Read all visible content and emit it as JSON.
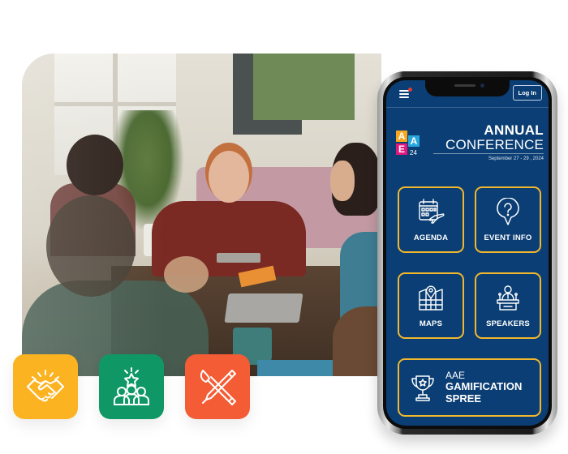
{
  "app": {
    "header": {
      "menu_icon": "hamburger-menu-icon",
      "notification_dot_color": "#e53935",
      "login_label": "Log In"
    },
    "brand": {
      "logo_letters": [
        "A",
        "A",
        "E"
      ],
      "logo_year": "24",
      "logo_colors": [
        "#f6a821",
        "#27a7de",
        "#e3177d"
      ],
      "title_line_1": "ANNUAL",
      "title_line_2": "CONFERENCE",
      "dates": "September 27 - 29 , 2024"
    },
    "nav_tiles": [
      {
        "label": "AGENDA",
        "icon": "calendar-plane-icon"
      },
      {
        "label": "EVENT INFO",
        "icon": "question-pin-icon"
      },
      {
        "label": "MAPS",
        "icon": "map-pin-icon"
      },
      {
        "label": "SPEAKERS",
        "icon": "speaker-podium-icon"
      }
    ],
    "gamification": {
      "line_1": "AAE",
      "line_2": "GAMIFICATION",
      "line_3": "SPREE",
      "icon": "trophy-icon"
    },
    "colors": {
      "screen_bg": "#0b3e74",
      "tile_border": "#f1b82d"
    }
  },
  "feature_tiles": [
    {
      "icon": "handshake-icon",
      "color": "#fbb321"
    },
    {
      "icon": "team-star-icon",
      "color": "#0f9866"
    },
    {
      "icon": "brush-pen-icon",
      "color": "#f45c35"
    }
  ],
  "photo": {
    "subject": "team-meeting-photo"
  }
}
